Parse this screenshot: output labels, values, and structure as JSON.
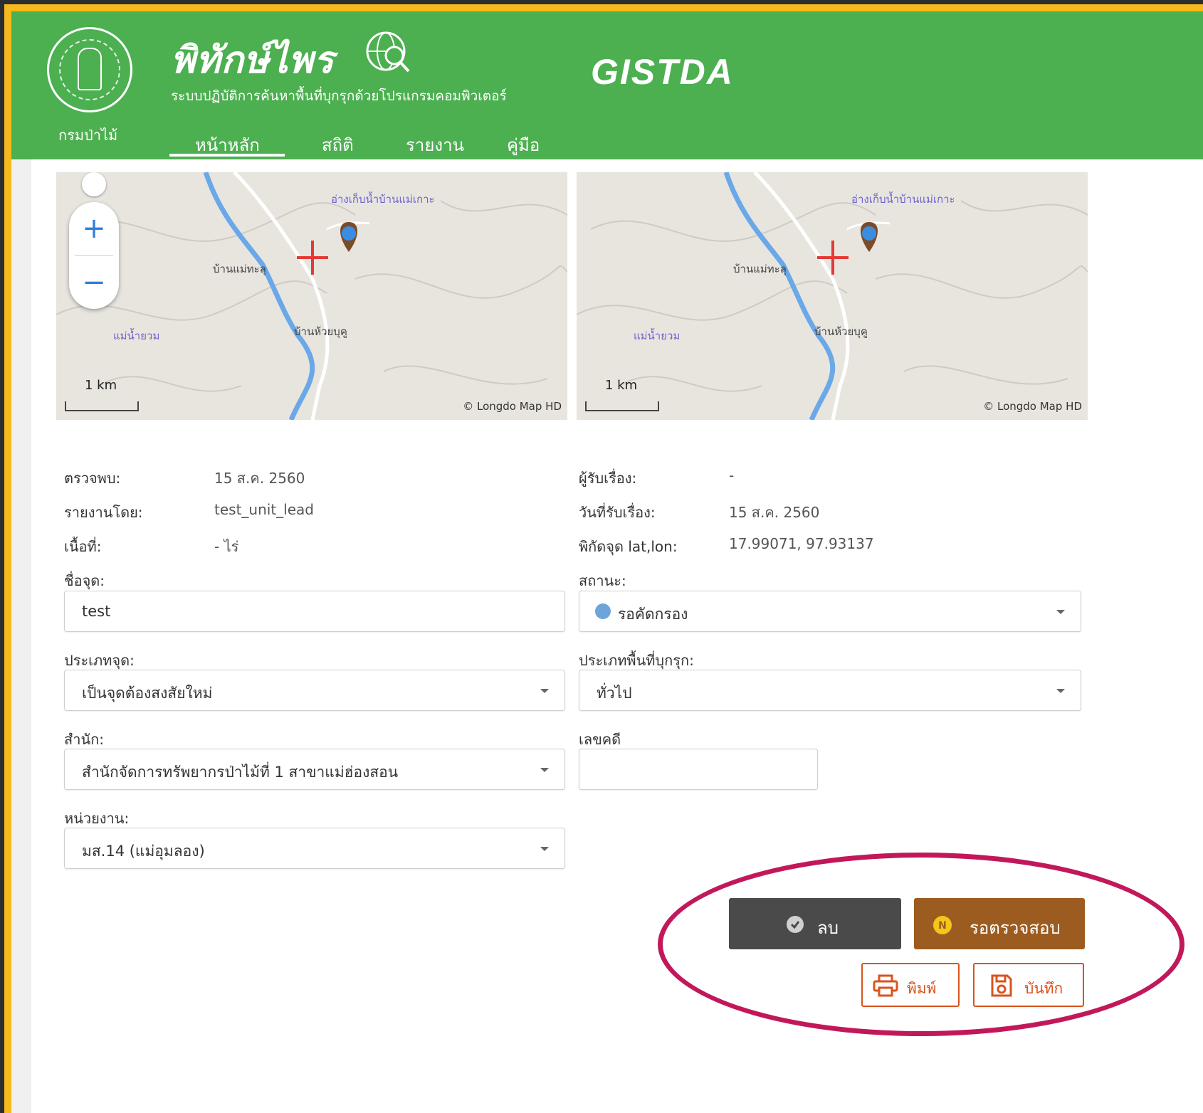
{
  "header": {
    "dept_label": "กรมป่าไม้",
    "app_title": "พิทักษ์ไพร",
    "app_subtitle": "ระบบปฏิบัติการค้นหาพื้นที่บุกรุกด้วยโปรแกรมคอมพิวเตอร์",
    "partner_logo": "GISTDA",
    "nav": [
      {
        "label": "หน้าหลัก",
        "active": true
      },
      {
        "label": "สถิติ",
        "active": false
      },
      {
        "label": "รายงาน",
        "active": false
      },
      {
        "label": "คู่มือ",
        "active": false
      }
    ]
  },
  "maps": [
    {
      "labels": [
        "อ่างเก็บน้ำบ้านแม่เกาะ",
        "บ้านแม่ทะลุ",
        "แม่น้ำยวม",
        "บ้านห้วยบุคู"
      ],
      "scale": "1 km",
      "copyright": "© Longdo Map HD",
      "zoom_in": "+",
      "zoom_out": "−"
    },
    {
      "labels": [
        "อ่างเก็บน้ำบ้านแม่เกาะ",
        "บ้านแม่ทะลุ",
        "แม่น้ำยวม",
        "บ้านห้วยบุคู"
      ],
      "scale": "1 km",
      "copyright": "© Longdo Map HD"
    }
  ],
  "info": {
    "detected_label": "ตรวจพบ:",
    "detected_value": "15 ส.ค. 2560",
    "reporter_label": "รายงานโดย:",
    "reporter_value": "test_unit_lead",
    "area_label": "เนื้อที่:",
    "area_value": "- ไร่",
    "receiver_label": "ผู้รับเรื่อง:",
    "receiver_value": "-",
    "received_date_label": "วันที่รับเรื่อง:",
    "received_date_value": "15 ส.ค. 2560",
    "coords_label": "พิกัดจุด lat,lon:",
    "coords_value": "17.99071, 97.93137"
  },
  "form": {
    "point_name_label": "ชื่อจุด:",
    "point_name_value": "test",
    "status_label": "สถานะ:",
    "status_value": "รอคัดกรอง",
    "point_type_label": "ประเภทจุด:",
    "point_type_value": "เป็นจุดต้องสงสัยใหม่",
    "encroach_type_label": "ประเภทพื้นที่บุกรุก:",
    "encroach_type_value": "ทั่วไป",
    "office_label": "สำนัก:",
    "office_value": "สำนักจัดการทรัพยากรป่าไม้ที่ 1 สาขาแม่ฮ่องสอน",
    "case_no_label": "เลขคดี",
    "case_no_value": "",
    "unit_label": "หน่วยงาน:",
    "unit_value": "มส.14 (แม่อุมลอง)"
  },
  "actions": {
    "delete": "ลบ",
    "verify": "รอตรวจสอบ",
    "print": "พิมพ์",
    "save": "บันทึก"
  },
  "colors": {
    "header_green": "#4caf50",
    "delete_btn": "#4a4a4a",
    "verify_btn": "#9c5c20",
    "outline_btn": "#d9531e",
    "highlight": "#c2185b"
  }
}
